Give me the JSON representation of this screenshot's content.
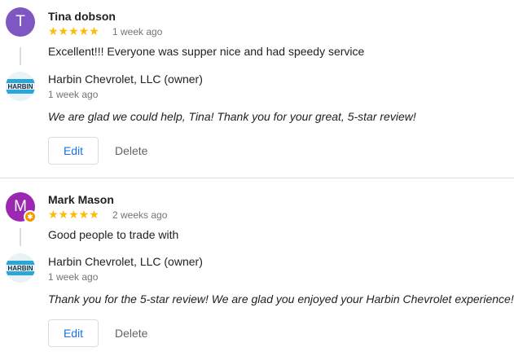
{
  "reviews": [
    {
      "avatar_letter": "T",
      "avatar_color": "#7e57c2",
      "name": "Tina dobson",
      "stars": "★★★★★",
      "time": "1 week ago",
      "text": "Excellent!!! Everyone was supper nice and had speedy service",
      "owner_logo_text": "HARBIN",
      "owner_name": "Harbin Chevrolet, LLC (owner)",
      "owner_time": "1 week ago",
      "reply": "We are glad we could help, Tina! Thank you for your great, 5-star review!",
      "edit_label": "Edit",
      "delete_label": "Delete"
    },
    {
      "avatar_letter": "M",
      "avatar_color": "#9c27b0",
      "badge_icon": "local-guide-star",
      "name": "Mark Mason",
      "stars": "★★★★★",
      "time": "2 weeks ago",
      "text": "Good people to trade with",
      "owner_logo_text": "HARBIN",
      "owner_name": "Harbin Chevrolet, LLC (owner)",
      "owner_time": "1 week ago",
      "reply": "Thank you for the 5-star review! We are glad you enjoyed your Harbin Chevrolet experience!",
      "edit_label": "Edit",
      "delete_label": "Delete"
    }
  ]
}
